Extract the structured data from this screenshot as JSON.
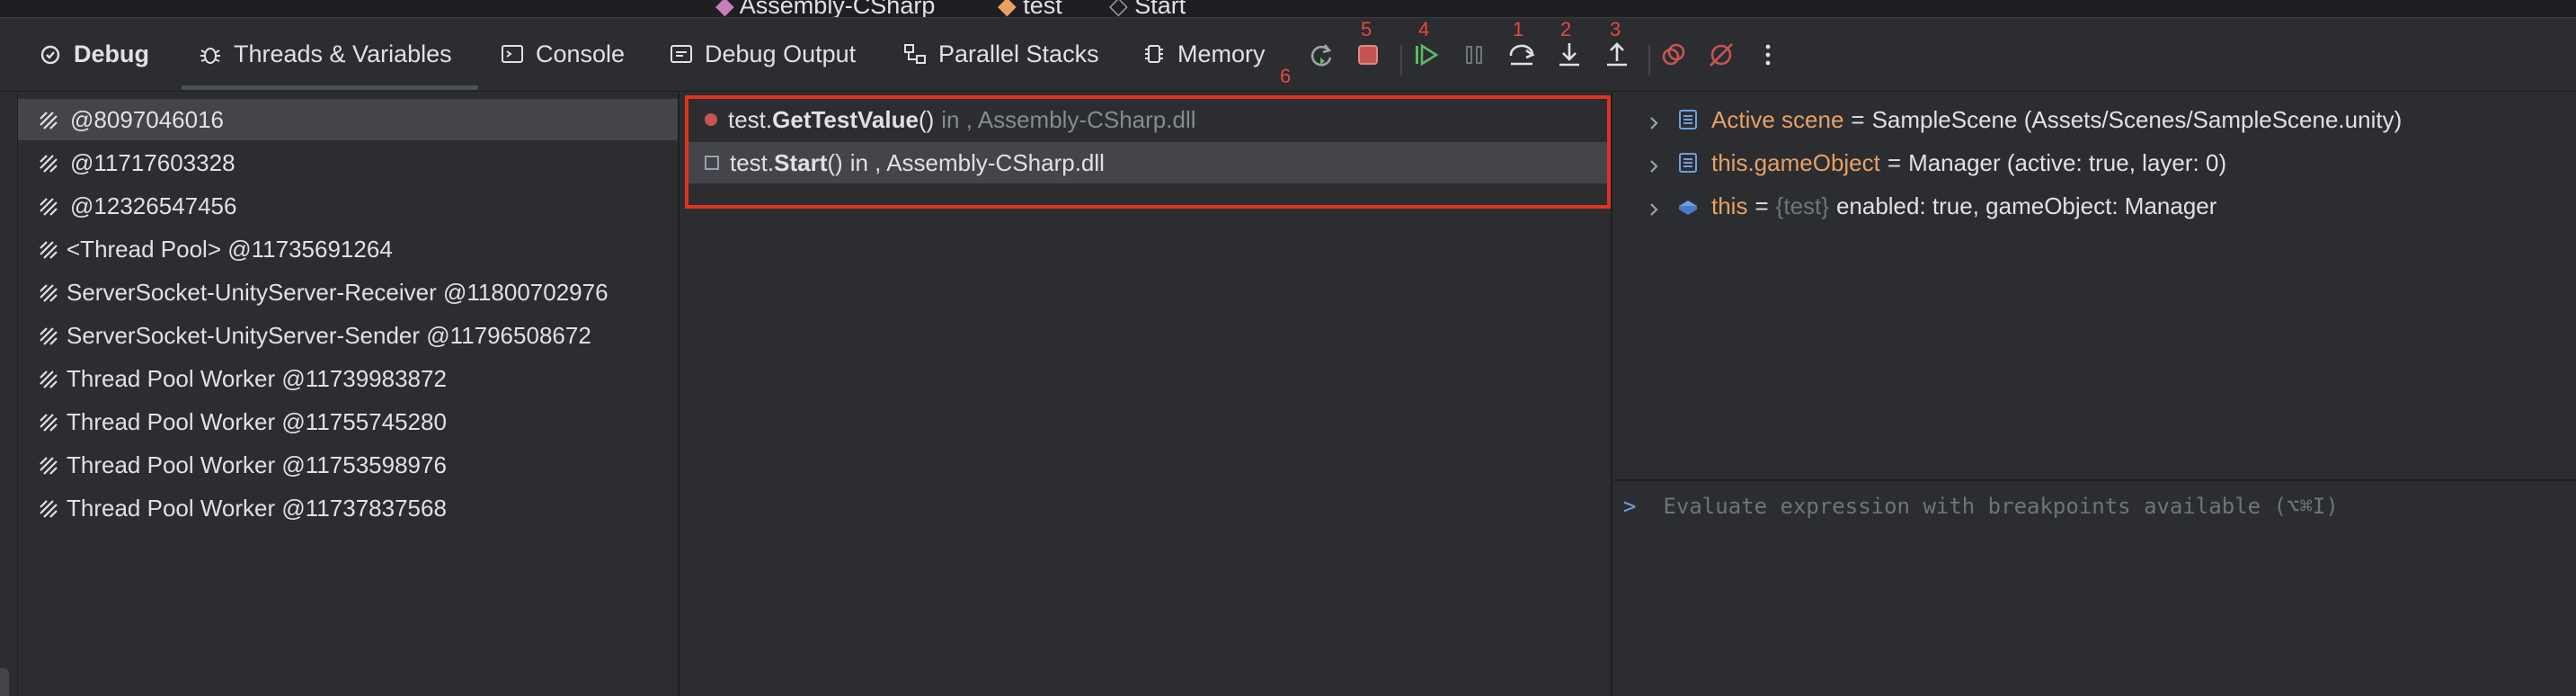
{
  "breadcrumb": {
    "project": "Assembly-CSharp",
    "class": "test",
    "method": "Start"
  },
  "toolbar": {
    "tabs": [
      {
        "label": "Debug"
      },
      {
        "label": "Threads & Variables"
      },
      {
        "label": "Console"
      },
      {
        "label": "Debug Output"
      },
      {
        "label": "Parallel Stacks"
      },
      {
        "label": "Memory"
      }
    ],
    "annotations": [
      "1",
      "2",
      "3",
      "4",
      "5",
      "6"
    ]
  },
  "threads": [
    {
      "label": "@8097046016"
    },
    {
      "label": "@11717603328"
    },
    {
      "label": "@12326547456"
    },
    {
      "label": "<Thread Pool> @11735691264"
    },
    {
      "label": "ServerSocket-UnityServer-Receiver @11800702976"
    },
    {
      "label": "ServerSocket-UnityServer-Sender @11796508672"
    },
    {
      "label": "Thread Pool Worker @11739983872"
    },
    {
      "label": "Thread Pool Worker @11755745280"
    },
    {
      "label": "Thread Pool Worker @11753598976"
    },
    {
      "label": "Thread Pool Worker @11737837568"
    }
  ],
  "frames": [
    {
      "prefix": "test.",
      "method": "GetTestValue",
      "suffix": "()",
      "location": "in , Assembly-CSharp.dll"
    },
    {
      "prefix": "test.",
      "method": "Start",
      "suffix": "()",
      "location": "in , Assembly-CSharp.dll"
    }
  ],
  "variables": [
    {
      "name": "Active scene",
      "eq": "=",
      "type": "",
      "value": "SampleScene (Assets/Scenes/SampleScene.unity)"
    },
    {
      "name": "this.gameObject",
      "eq": "=",
      "type": "",
      "value": "Manager (active: true, layer: 0)"
    },
    {
      "name": "this",
      "eq": "=",
      "type": "{test}",
      "value": "enabled: true, gameObject: Manager"
    }
  ],
  "evaluate": {
    "prompt": ">",
    "placeholder": "Evaluate expression with breakpoints available (⌥⌘I)"
  },
  "colors": {
    "accent_red": "#e03320",
    "breakpoint": "#c75450",
    "var_name": "#e8a065",
    "resume_green": "#5fb865",
    "background": "#2b2d30"
  }
}
